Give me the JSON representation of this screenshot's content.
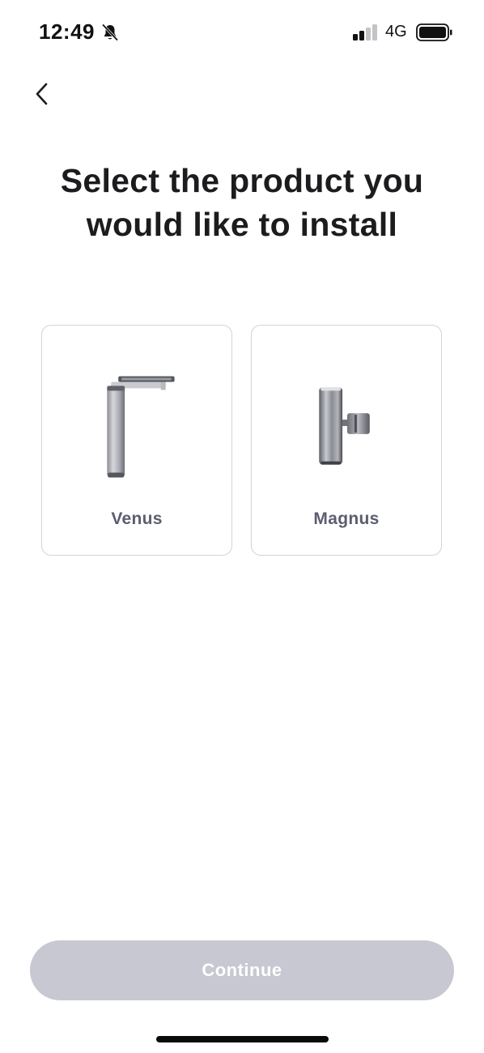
{
  "status_bar": {
    "time": "12:49",
    "network": "4G",
    "icons": [
      "bell-slash-icon",
      "signal-icon",
      "battery-icon"
    ]
  },
  "header": {
    "back_icon": "chevron-left-icon"
  },
  "title": "Select the product you would like to install",
  "products": [
    {
      "name": "Venus",
      "image": "venus-product-image"
    },
    {
      "name": "Magnus",
      "image": "magnus-product-image"
    }
  ],
  "footer": {
    "continue_label": "Continue",
    "continue_enabled": false
  },
  "colors": {
    "title": "#1c1c1e",
    "card_border": "#d3d3d8",
    "product_label": "#5b5d70",
    "button_disabled_bg": "#c7c8d1",
    "button_text": "#ffffff"
  }
}
